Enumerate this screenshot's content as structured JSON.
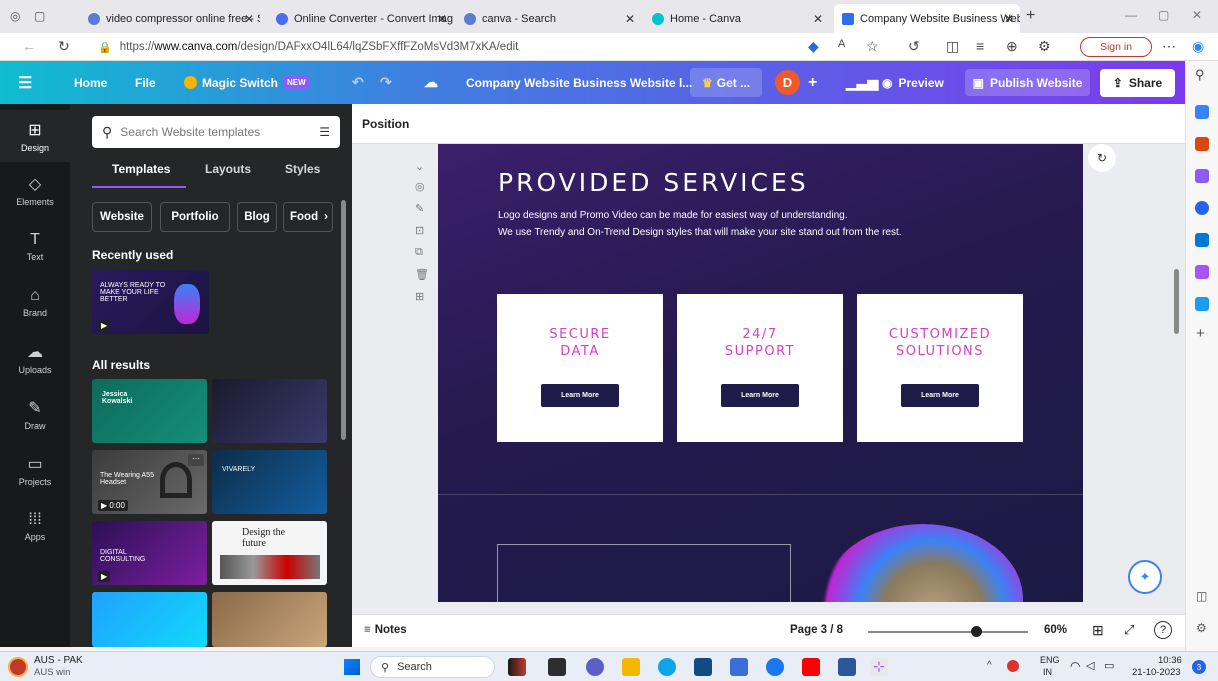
{
  "browser": {
    "tabs": [
      {
        "title": "video compressor online free - S"
      },
      {
        "title": "Online Converter - Convert Imag"
      },
      {
        "title": "canva - Search"
      },
      {
        "title": "Home - Canva"
      },
      {
        "title": "Company Website Business Web"
      }
    ],
    "url_prefix": "https://",
    "url_domain": "www.canva.com",
    "url_path": "/design/DAFxxO4lL64/lqZSbFXffFZoMsVd3M7xKA/edit",
    "sign_in": "Sign in"
  },
  "header": {
    "menu_icon": "hamburger-icon",
    "home": "Home",
    "file": "File",
    "magic_switch": "Magic Switch",
    "new_badge": "NEW",
    "doc_title": "Company Website Business Website l...",
    "get_label": "Get ...",
    "avatar_letter": "D",
    "preview": "Preview",
    "publish": "Publish Website",
    "share": "Share"
  },
  "rail": {
    "items": [
      {
        "label": "Design",
        "icon": "design-icon"
      },
      {
        "label": "Elements",
        "icon": "elements-icon"
      },
      {
        "label": "Text",
        "icon": "text-icon"
      },
      {
        "label": "Brand",
        "icon": "brand-icon"
      },
      {
        "label": "Uploads",
        "icon": "uploads-icon"
      },
      {
        "label": "Draw",
        "icon": "draw-icon"
      },
      {
        "label": "Projects",
        "icon": "projects-icon"
      },
      {
        "label": "Apps",
        "icon": "apps-icon"
      }
    ]
  },
  "panel": {
    "search_placeholder": "Search Website templates",
    "tabs": [
      "Templates",
      "Layouts",
      "Styles"
    ],
    "chips": [
      "Website",
      "Portfolio",
      "Blog",
      "Food"
    ],
    "recently_used": "Recently used",
    "all_results": "All results",
    "recent_thumb_text": "ALWAYS READY TO MAKE YOUR LIFE BETTER",
    "thumbs": [
      {
        "text": "Jessica Kowalski"
      },
      {
        "text": ""
      },
      {
        "text": "The Wearing A55 Headset",
        "duration": "0:00"
      },
      {
        "text": "VIVARELY"
      },
      {
        "text": "DIGITAL CONSULTING"
      },
      {
        "text": "Design the future"
      },
      {
        "text": ""
      },
      {
        "text": ""
      }
    ]
  },
  "canvas_toolbar": {
    "position_label": "Position"
  },
  "design": {
    "heading": "PROVIDED SERVICES",
    "line1": "Logo designs and Promo Video can be made for easiest way of understanding.",
    "line2": "We use Trendy and On-Trend Design styles that will make your site stand out from the rest.",
    "cards": [
      {
        "title1": "SECURE",
        "title2": "DATA",
        "button": "Learn More"
      },
      {
        "title1": "24/7",
        "title2": "SUPPORT",
        "button": "Learn More"
      },
      {
        "title1": "CUSTOMIZED",
        "title2": "SOLUTIONS",
        "button": "Learn More"
      }
    ]
  },
  "bottom": {
    "notes": "Notes",
    "page": "Page 3 / 8",
    "zoom": "60%",
    "zoom_level": 0.6
  },
  "taskbar": {
    "weather_title": "AUS - PAK",
    "weather_sub": "AUS win",
    "search": "Search",
    "lang1": "ENG",
    "lang2": "IN",
    "time": "10:36",
    "date": "21-10-2023",
    "notif_count": "3"
  },
  "colors": {
    "accent": "#7c3aed",
    "card_title": "#d63fc9",
    "button_dark": "#1f1c4a"
  }
}
